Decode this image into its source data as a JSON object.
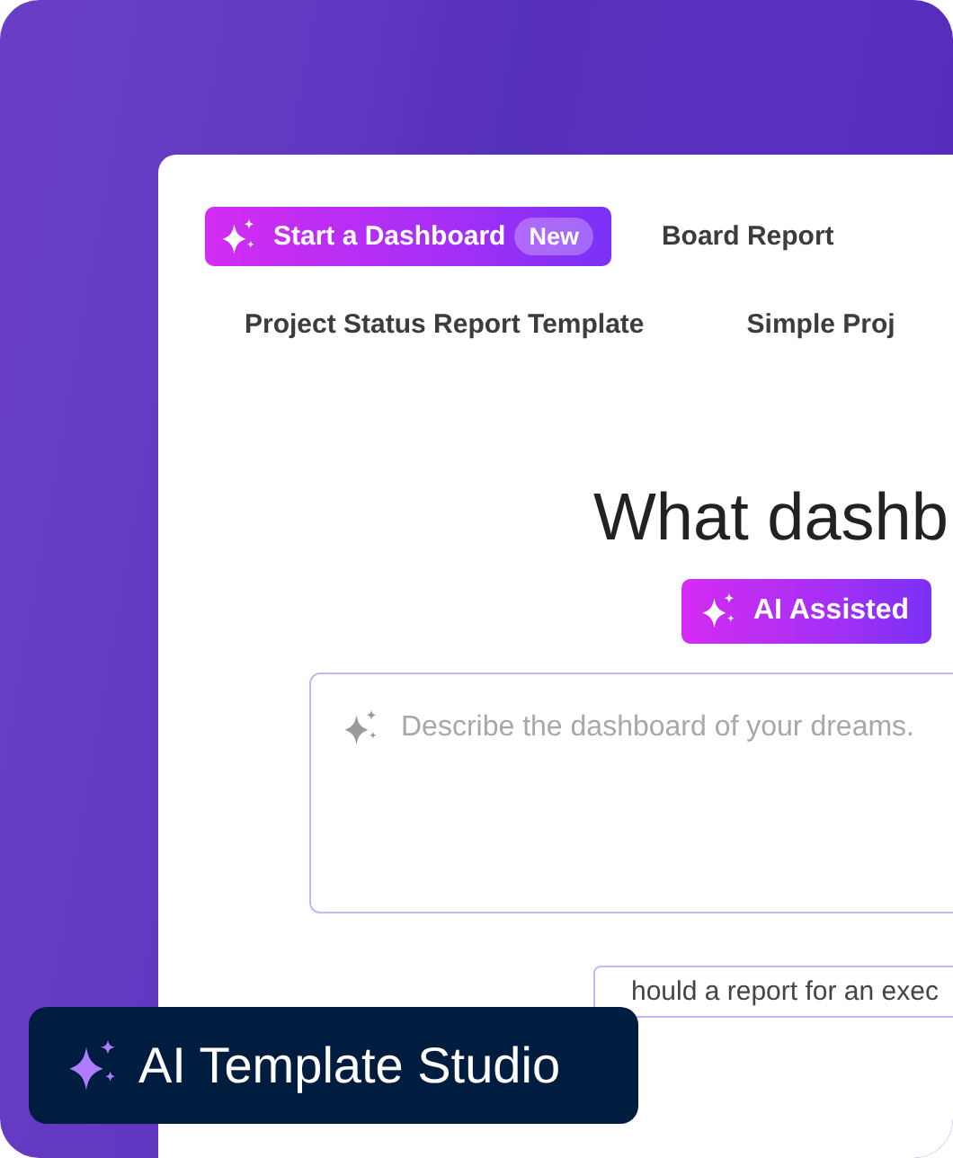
{
  "tab_rows": [
    {
      "items": [
        {
          "kind": "ai",
          "label": "Start a Dashboard",
          "badge": "New"
        },
        {
          "kind": "plain",
          "label": "Board Report"
        }
      ]
    },
    {
      "items": [
        {
          "kind": "plain",
          "label": "Project Status Report Template"
        },
        {
          "kind": "plain",
          "label": "Simple Proj"
        }
      ]
    }
  ],
  "heading": "What dashb",
  "mode_button": {
    "label": "AI Assisted"
  },
  "prompt": {
    "placeholder": "Describe the dashboard of your dreams."
  },
  "suggestion": "hould a report for an exec",
  "product_badge": {
    "label": "AI Template Studio"
  }
}
